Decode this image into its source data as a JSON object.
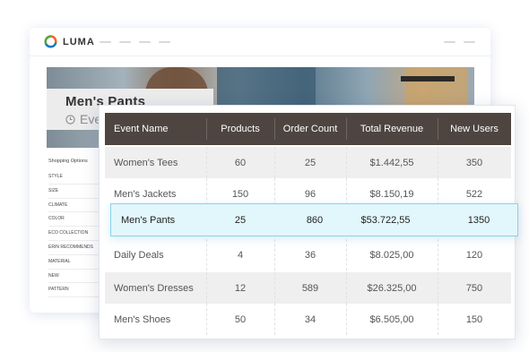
{
  "browser": {
    "brand": "LUMA",
    "page_title": "Men's Pants",
    "subtitle": "Eve",
    "filters_heading": "Shopping Options",
    "filters": [
      "STYLE",
      "SIZE",
      "CLIMATE",
      "COLOR",
      "ECO COLLECTION",
      "ERIN RECOMMENDS",
      "MATERIAL",
      "NEW",
      "PATTERN"
    ]
  },
  "table": {
    "headers": [
      "Event Name",
      "Products",
      "Order Count",
      "Total Revenue",
      "New Users"
    ],
    "rows": [
      {
        "event": "Women's Tees",
        "products": "60",
        "orders": "25",
        "revenue": "$1.442,55",
        "users": "350"
      },
      {
        "event": "Men's Jackets",
        "products": "150",
        "orders": "96",
        "revenue": "$8.150,19",
        "users": "522"
      },
      {
        "event": "Men's Pants",
        "products": "25",
        "orders": "860",
        "revenue": "$53.722,55",
        "users": "1350"
      },
      {
        "event": "Daily Deals",
        "products": "4",
        "orders": "36",
        "revenue": "$8.025,00",
        "users": "120"
      },
      {
        "event": "Women's Dresses",
        "products": "12",
        "orders": "589",
        "revenue": "$26.325,00",
        "users": "750"
      },
      {
        "event": "Men's Shoes",
        "products": "50",
        "orders": "34",
        "revenue": "$6.505,00",
        "users": "150"
      }
    ]
  },
  "colors": {
    "header_bg": "#4e4540",
    "highlight_bg": "#e2f7fc",
    "highlight_border": "#86d3ea",
    "logo_orange": "#f26322",
    "logo_blue": "#1979c3",
    "logo_green": "#5ba236"
  }
}
